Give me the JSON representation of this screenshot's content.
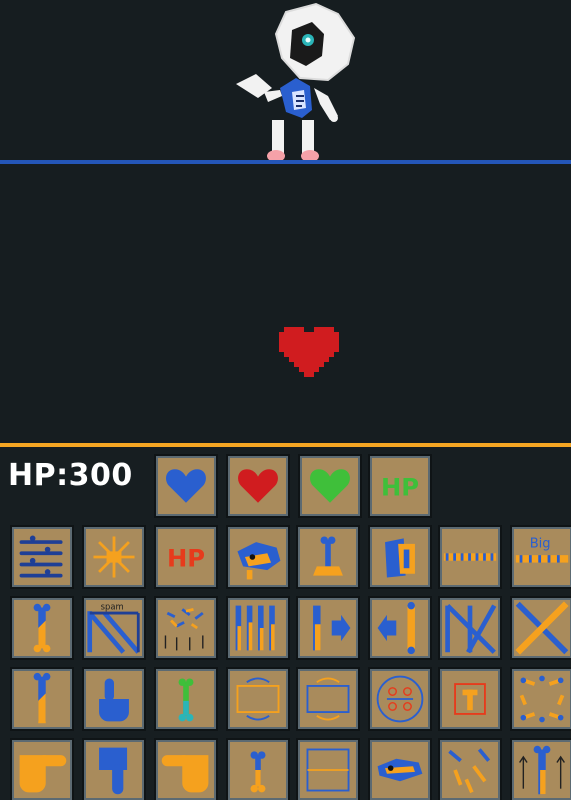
{
  "hud": {
    "hp_label": "HP:300"
  },
  "colors": {
    "background": "#171e21",
    "arena_line_blue": "#2456b8",
    "arena_line_orange": "#f5a623",
    "tile_bg": "#a98b5c",
    "soul_red": "#d01c1f",
    "attack_blue": "#2a5fcf",
    "attack_orange": "#f5a11e"
  },
  "soul_modes": [
    {
      "icon": "blue-heart-icon"
    },
    {
      "icon": "red-heart-icon"
    },
    {
      "icon": "green-heart-icon"
    },
    {
      "icon": "green-hp-icon",
      "label": "HP"
    }
  ],
  "attack_tiles": {
    "row1": [
      {
        "icon": "blue-bone-waves-icon"
      },
      {
        "icon": "orange-burst-arrows-icon"
      },
      {
        "icon": "red-hp-icon",
        "label": "HP"
      },
      {
        "icon": "gaster-blaster-icon"
      },
      {
        "icon": "bone-on-platform-icon"
      },
      {
        "icon": "blue-orange-blaster-icon"
      },
      {
        "icon": "bone-strip-icon"
      },
      {
        "icon": "big-bone-strip-icon",
        "label": "Big"
      }
    ],
    "row2": [
      {
        "icon": "tall-bone-icon"
      },
      {
        "icon": "bone-spam-icon",
        "label": "spam"
      },
      {
        "icon": "falling-bones-icon"
      },
      {
        "icon": "bone-wall-icon"
      },
      {
        "icon": "bone-right-arrow-icon"
      },
      {
        "icon": "bone-left-arrow-icon"
      },
      {
        "icon": "blue-cross-bones-icon"
      },
      {
        "icon": "orange-cross-bones-icon"
      }
    ],
    "row3": [
      {
        "icon": "bone-rising-icon"
      },
      {
        "icon": "blue-finger-up-icon"
      },
      {
        "icon": "green-bone-icon"
      },
      {
        "icon": "box-rotate-icon"
      },
      {
        "icon": "box-rotate-alt-icon"
      },
      {
        "icon": "circle-symbols-icon"
      },
      {
        "icon": "orange-t-box-icon"
      },
      {
        "icon": "bone-ring-icon"
      }
    ],
    "row4": [
      {
        "icon": "orange-finger-right-icon"
      },
      {
        "icon": "blue-finger-down-icon"
      },
      {
        "icon": "orange-finger-left-icon"
      },
      {
        "icon": "small-bone-icon"
      },
      {
        "icon": "box-split-icon"
      },
      {
        "icon": "blaster-head-icon"
      },
      {
        "icon": "scatter-bones-icon"
      },
      {
        "icon": "bone-up-arrows-icon"
      }
    ]
  }
}
